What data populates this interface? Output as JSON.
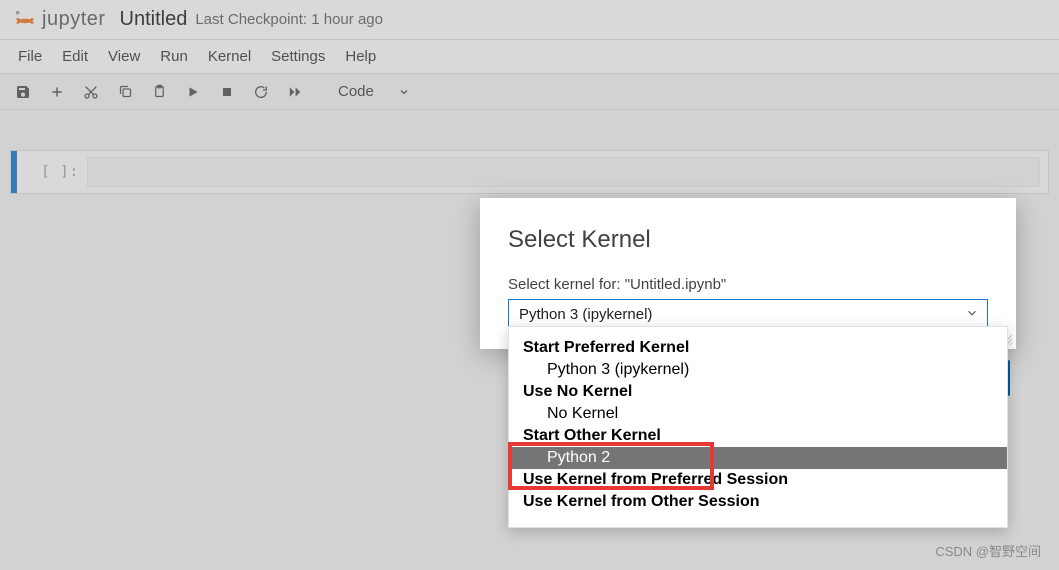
{
  "brand": {
    "name": "jupyter"
  },
  "document": {
    "title": "Untitled",
    "checkpoint": "Last Checkpoint: 1 hour ago"
  },
  "menu": {
    "file": "File",
    "edit": "Edit",
    "view": "View",
    "run": "Run",
    "kernel": "Kernel",
    "settings": "Settings",
    "help": "Help"
  },
  "toolbar": {
    "celltype": "Code"
  },
  "cell": {
    "prompt": "[ ]:"
  },
  "dialog": {
    "title": "Select Kernel",
    "label_prefix": "Select kernel for: ",
    "label_file": "\"Untitled.ipynb\"",
    "select_value": "Python 3 (ipykernel)"
  },
  "dropdown": {
    "group1_label": "Start Preferred Kernel",
    "group1_item": "Python 3 (ipykernel)",
    "group2_label": "Use No Kernel",
    "group2_item": "No Kernel",
    "group3_label": "Start Other Kernel",
    "group3_item": "Python 2",
    "group4_label": "Use Kernel from Preferred Session",
    "group5_label": "Use Kernel from Other Session"
  },
  "watermark": "CSDN @智野空间"
}
